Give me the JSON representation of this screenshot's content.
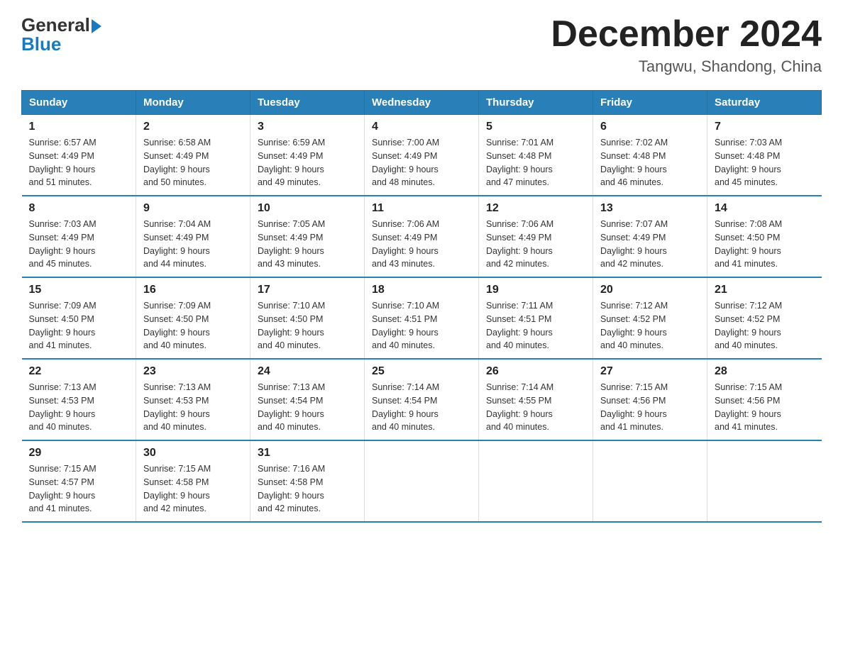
{
  "logo": {
    "general": "General",
    "blue": "Blue"
  },
  "header": {
    "month_year": "December 2024",
    "location": "Tangwu, Shandong, China"
  },
  "columns": [
    "Sunday",
    "Monday",
    "Tuesday",
    "Wednesday",
    "Thursday",
    "Friday",
    "Saturday"
  ],
  "weeks": [
    [
      {
        "num": "1",
        "sunrise": "6:57 AM",
        "sunset": "4:49 PM",
        "daylight": "9 hours and 51 minutes."
      },
      {
        "num": "2",
        "sunrise": "6:58 AM",
        "sunset": "4:49 PM",
        "daylight": "9 hours and 50 minutes."
      },
      {
        "num": "3",
        "sunrise": "6:59 AM",
        "sunset": "4:49 PM",
        "daylight": "9 hours and 49 minutes."
      },
      {
        "num": "4",
        "sunrise": "7:00 AM",
        "sunset": "4:49 PM",
        "daylight": "9 hours and 48 minutes."
      },
      {
        "num": "5",
        "sunrise": "7:01 AM",
        "sunset": "4:48 PM",
        "daylight": "9 hours and 47 minutes."
      },
      {
        "num": "6",
        "sunrise": "7:02 AM",
        "sunset": "4:48 PM",
        "daylight": "9 hours and 46 minutes."
      },
      {
        "num": "7",
        "sunrise": "7:03 AM",
        "sunset": "4:48 PM",
        "daylight": "9 hours and 45 minutes."
      }
    ],
    [
      {
        "num": "8",
        "sunrise": "7:03 AM",
        "sunset": "4:49 PM",
        "daylight": "9 hours and 45 minutes."
      },
      {
        "num": "9",
        "sunrise": "7:04 AM",
        "sunset": "4:49 PM",
        "daylight": "9 hours and 44 minutes."
      },
      {
        "num": "10",
        "sunrise": "7:05 AM",
        "sunset": "4:49 PM",
        "daylight": "9 hours and 43 minutes."
      },
      {
        "num": "11",
        "sunrise": "7:06 AM",
        "sunset": "4:49 PM",
        "daylight": "9 hours and 43 minutes."
      },
      {
        "num": "12",
        "sunrise": "7:06 AM",
        "sunset": "4:49 PM",
        "daylight": "9 hours and 42 minutes."
      },
      {
        "num": "13",
        "sunrise": "7:07 AM",
        "sunset": "4:49 PM",
        "daylight": "9 hours and 42 minutes."
      },
      {
        "num": "14",
        "sunrise": "7:08 AM",
        "sunset": "4:50 PM",
        "daylight": "9 hours and 41 minutes."
      }
    ],
    [
      {
        "num": "15",
        "sunrise": "7:09 AM",
        "sunset": "4:50 PM",
        "daylight": "9 hours and 41 minutes."
      },
      {
        "num": "16",
        "sunrise": "7:09 AM",
        "sunset": "4:50 PM",
        "daylight": "9 hours and 40 minutes."
      },
      {
        "num": "17",
        "sunrise": "7:10 AM",
        "sunset": "4:50 PM",
        "daylight": "9 hours and 40 minutes."
      },
      {
        "num": "18",
        "sunrise": "7:10 AM",
        "sunset": "4:51 PM",
        "daylight": "9 hours and 40 minutes."
      },
      {
        "num": "19",
        "sunrise": "7:11 AM",
        "sunset": "4:51 PM",
        "daylight": "9 hours and 40 minutes."
      },
      {
        "num": "20",
        "sunrise": "7:12 AM",
        "sunset": "4:52 PM",
        "daylight": "9 hours and 40 minutes."
      },
      {
        "num": "21",
        "sunrise": "7:12 AM",
        "sunset": "4:52 PM",
        "daylight": "9 hours and 40 minutes."
      }
    ],
    [
      {
        "num": "22",
        "sunrise": "7:13 AM",
        "sunset": "4:53 PM",
        "daylight": "9 hours and 40 minutes."
      },
      {
        "num": "23",
        "sunrise": "7:13 AM",
        "sunset": "4:53 PM",
        "daylight": "9 hours and 40 minutes."
      },
      {
        "num": "24",
        "sunrise": "7:13 AM",
        "sunset": "4:54 PM",
        "daylight": "9 hours and 40 minutes."
      },
      {
        "num": "25",
        "sunrise": "7:14 AM",
        "sunset": "4:54 PM",
        "daylight": "9 hours and 40 minutes."
      },
      {
        "num": "26",
        "sunrise": "7:14 AM",
        "sunset": "4:55 PM",
        "daylight": "9 hours and 40 minutes."
      },
      {
        "num": "27",
        "sunrise": "7:15 AM",
        "sunset": "4:56 PM",
        "daylight": "9 hours and 41 minutes."
      },
      {
        "num": "28",
        "sunrise": "7:15 AM",
        "sunset": "4:56 PM",
        "daylight": "9 hours and 41 minutes."
      }
    ],
    [
      {
        "num": "29",
        "sunrise": "7:15 AM",
        "sunset": "4:57 PM",
        "daylight": "9 hours and 41 minutes."
      },
      {
        "num": "30",
        "sunrise": "7:15 AM",
        "sunset": "4:58 PM",
        "daylight": "9 hours and 42 minutes."
      },
      {
        "num": "31",
        "sunrise": "7:16 AM",
        "sunset": "4:58 PM",
        "daylight": "9 hours and 42 minutes."
      },
      null,
      null,
      null,
      null
    ]
  ],
  "labels": {
    "sunrise": "Sunrise:",
    "sunset": "Sunset:",
    "daylight": "Daylight:"
  }
}
